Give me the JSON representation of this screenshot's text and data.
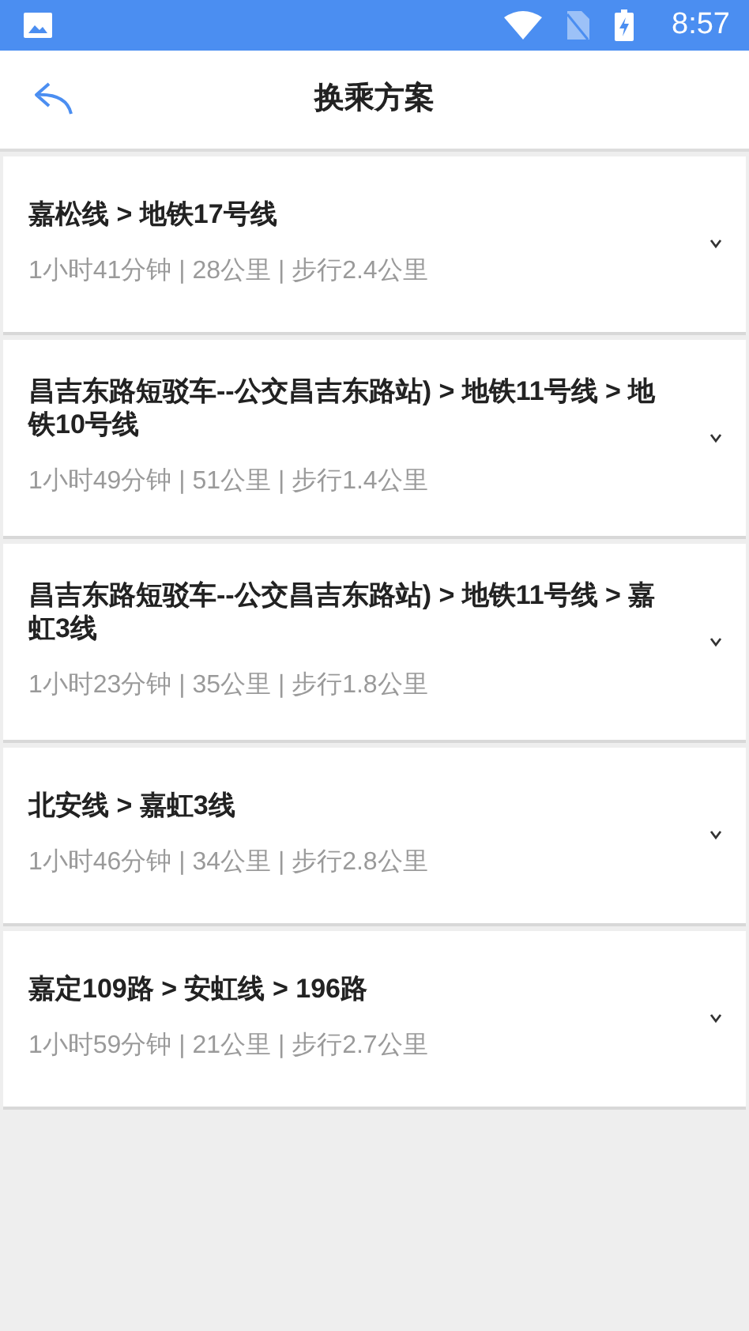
{
  "status_bar": {
    "time": "8:57"
  },
  "header": {
    "title": "换乘方案"
  },
  "routes": [
    {
      "lines": "嘉松线 > 地铁17号线",
      "summary": "1小时41分钟 | 28公里 | 步行2.4公里"
    },
    {
      "lines": "昌吉东路短驳车--公交昌吉东路站) > 地铁11号线 > 地铁10号线",
      "summary": "1小时49分钟 | 51公里 | 步行1.4公里"
    },
    {
      "lines": "昌吉东路短驳车--公交昌吉东路站) > 地铁11号线 > 嘉虹3线",
      "summary": "1小时23分钟 | 35公里 | 步行1.8公里"
    },
    {
      "lines": "北安线 > 嘉虹3线",
      "summary": "1小时46分钟 | 34公里 | 步行2.8公里"
    },
    {
      "lines": "嘉定109路 > 安虹线 > 196路",
      "summary": "1小时59分钟 | 21公里 | 步行2.7公里"
    }
  ]
}
